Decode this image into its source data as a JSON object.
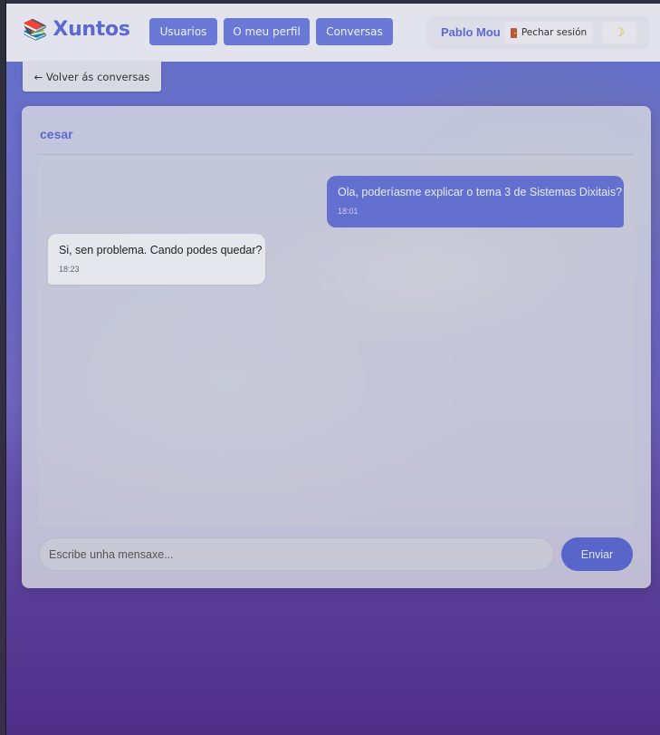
{
  "header": {
    "logo_icon": "books-icon",
    "logo_text": "Xuntos",
    "nav": [
      {
        "label": "Usuarios"
      },
      {
        "label": "O meu perfil"
      },
      {
        "label": "Conversas"
      }
    ],
    "user_name": "Pablo Mou",
    "logout_label": "Pechar sesión",
    "logout_icon": "door-icon",
    "theme_icon": "moon-icon"
  },
  "back_label": "← Volver ás conversas",
  "chat": {
    "contact_name": "cesar",
    "messages": [
      {
        "direction": "sent",
        "text": "Ola, poderíasme explicar o tema 3 de Sistemas Dixitais?",
        "time": "18:01"
      },
      {
        "direction": "received",
        "text": "Si, sen problema. Cando podes quedar?",
        "time": "18:23"
      }
    ],
    "input_placeholder": "Escribe unha mensaxe...",
    "input_value": "",
    "send_label": "Enviar"
  },
  "colors": {
    "accent": "#5b6ad0",
    "nav_button": "#6a78d6",
    "sent_bubble": "#6470cf",
    "send_button": "#5866c9"
  }
}
